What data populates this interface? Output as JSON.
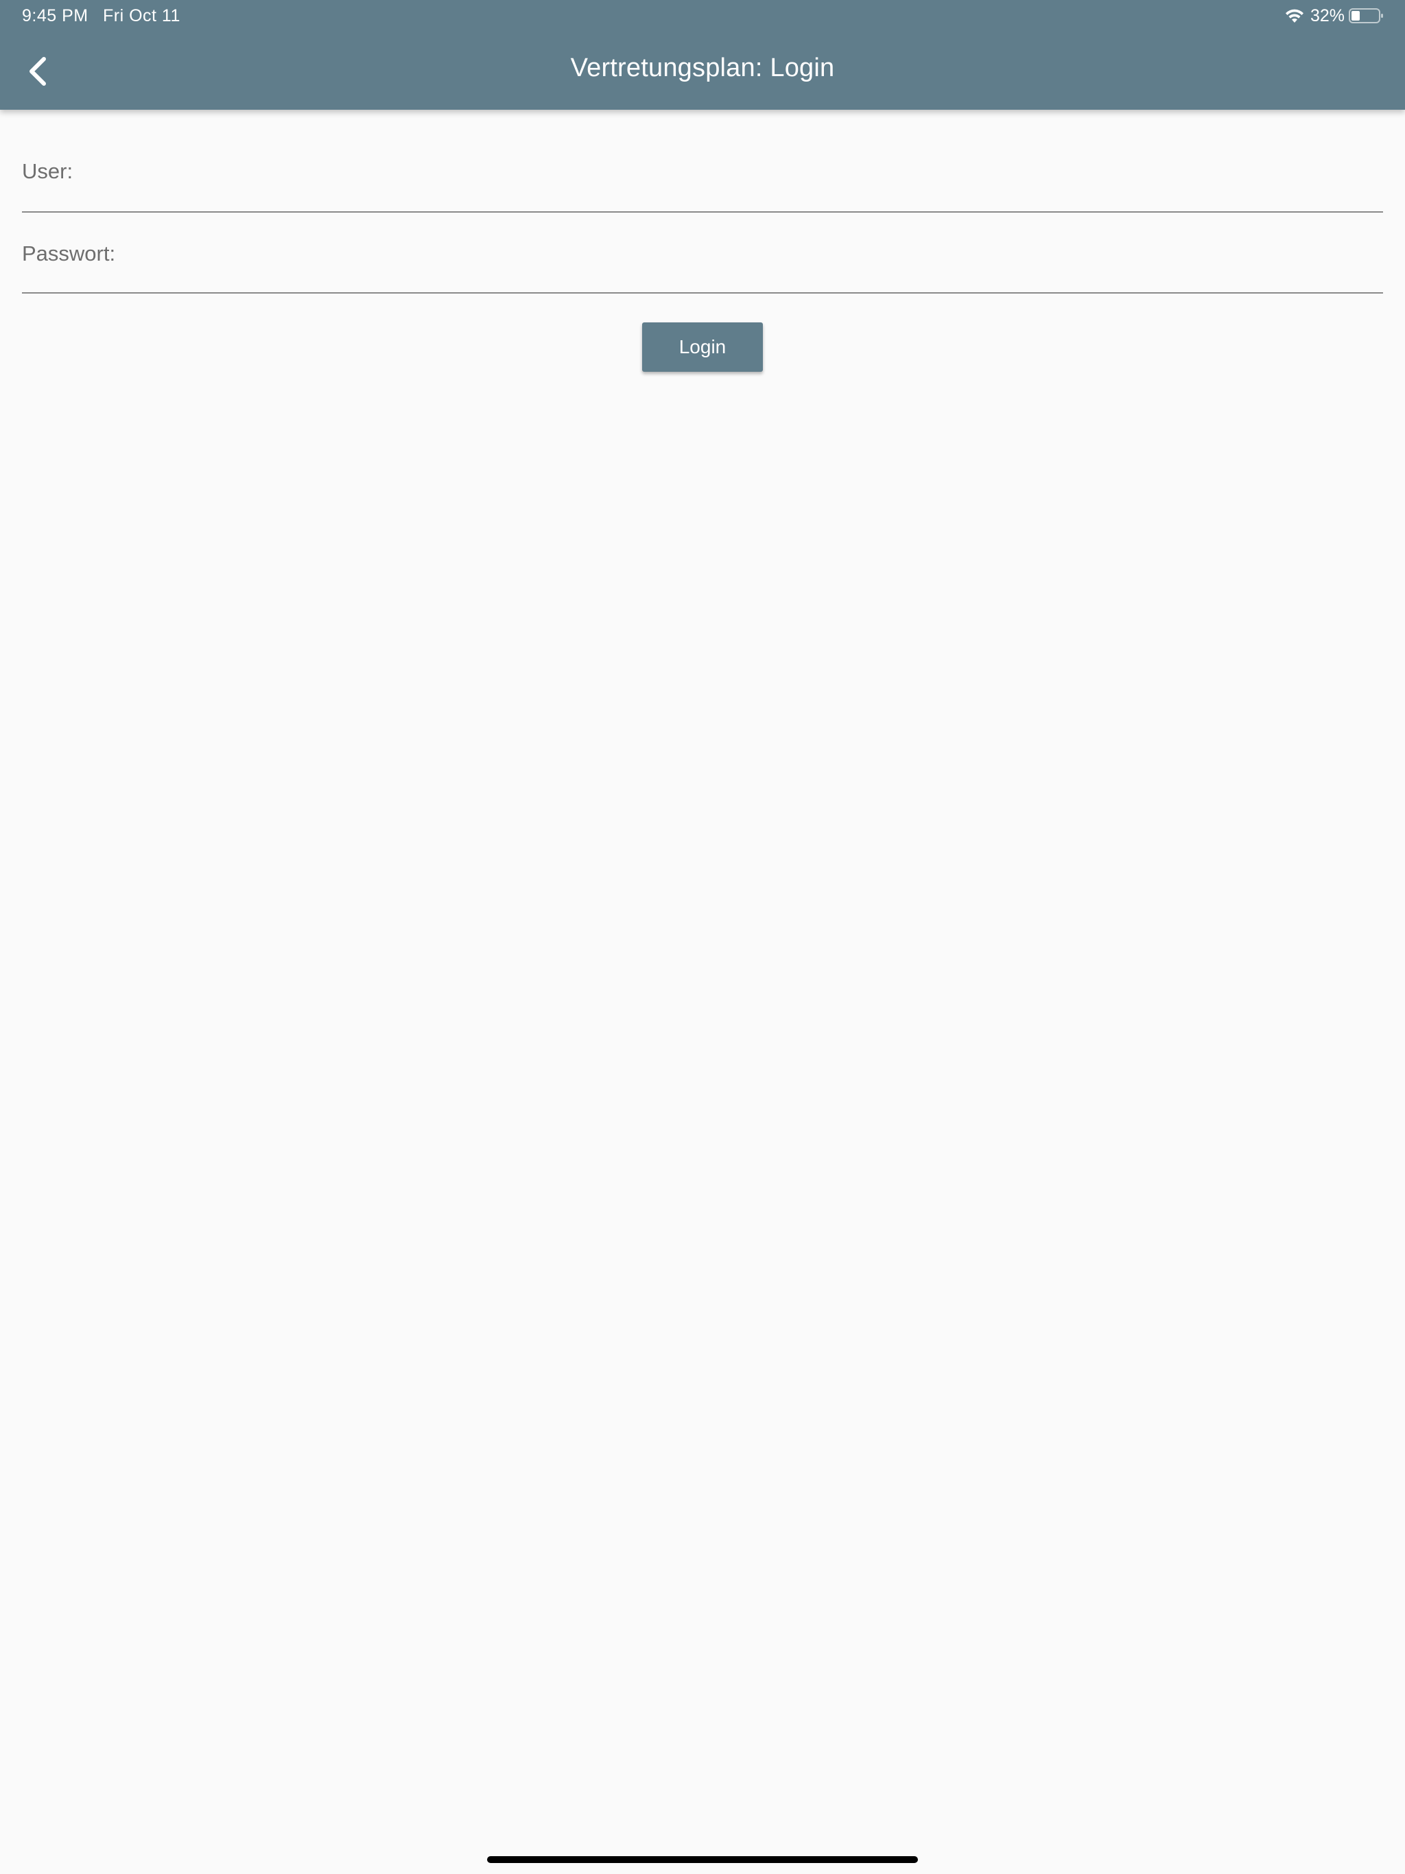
{
  "status_bar": {
    "time": "9:45 PM",
    "date": "Fri Oct 11",
    "battery_percent": "32%",
    "battery_level": 0.32,
    "wifi_icon": "wifi-icon",
    "battery_icon": "battery-icon"
  },
  "toolbar": {
    "title": "Vertretungsplan: Login",
    "back_icon": "chevron-left-icon"
  },
  "form": {
    "user_label": "User:",
    "user_value": "",
    "password_label": "Passwort:",
    "password_value": "",
    "login_label": "Login"
  },
  "colors": {
    "primary": "#607d8b",
    "background": "#fafafa",
    "label": "#6e6e6e",
    "underline": "#8a8a8a"
  }
}
